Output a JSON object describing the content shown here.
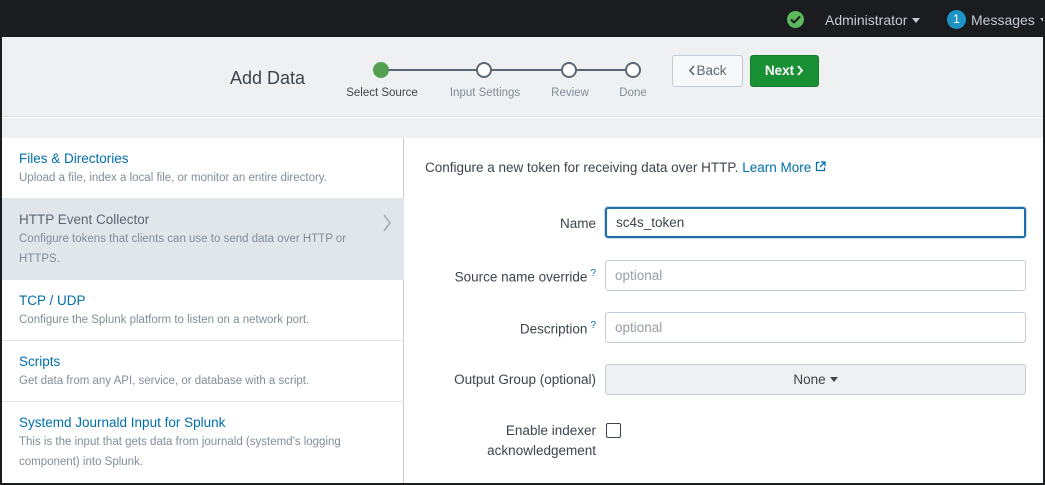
{
  "topbar": {
    "user_menu": "Administrator",
    "messages_count": "1",
    "messages_menu": "Messages"
  },
  "header": {
    "title": "Add Data",
    "steps": [
      {
        "label": "Select Source",
        "state": "active"
      },
      {
        "label": "Input Settings",
        "state": "pending"
      },
      {
        "label": "Review",
        "state": "pending"
      },
      {
        "label": "Done",
        "state": "pending"
      }
    ],
    "back_label": "Back",
    "next_label": "Next"
  },
  "sidebar": {
    "items": [
      {
        "title": "Files & Directories",
        "description": "Upload a file, index a local file, or monitor an entire directory.",
        "selected": false
      },
      {
        "title": "HTTP Event Collector",
        "description": "Configure tokens that clients can use to send data over HTTP or HTTPS.",
        "selected": true
      },
      {
        "title": "TCP / UDP",
        "description": "Configure the Splunk platform to listen on a network port.",
        "selected": false
      },
      {
        "title": "Scripts",
        "description": "Get data from any API, service, or database with a script.",
        "selected": false
      },
      {
        "title": "Systemd Journald Input for Splunk",
        "description": "This is the input that gets data from journald (systemd's logging component) into Splunk.",
        "selected": false
      }
    ]
  },
  "form": {
    "intro": "Configure a new token for receiving data over HTTP.",
    "learn_more": "Learn More",
    "name_label": "Name",
    "name_value": "sc4s_token",
    "source_label": "Source name override",
    "source_placeholder": "optional",
    "description_label": "Description",
    "description_placeholder": "optional",
    "help_mark": "?",
    "output_group_label": "Output Group (optional)",
    "output_group_value": "None",
    "ack_label_line1": "Enable indexer",
    "ack_label_line2": "acknowledgement",
    "ack_checked": false
  },
  "colors": {
    "topbar_bg": "#1a1c20",
    "header_bg": "#eef0f2",
    "next_button": "#1a9035",
    "active_step": "#53a051",
    "link": "#006eaa",
    "status_ok": "#5cb85c",
    "badge": "#1e93c6"
  },
  "icons": {
    "status": "check-circle-icon",
    "learn_more": "external-link-icon",
    "selected_item": "chevron-right-icon"
  }
}
